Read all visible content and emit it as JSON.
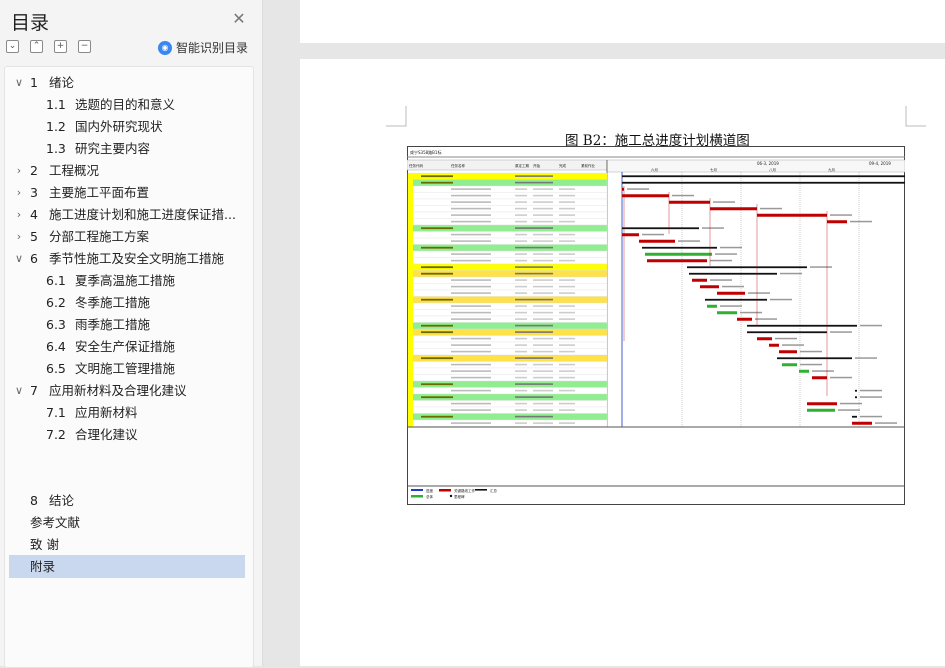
{
  "sidebar": {
    "title": "目录",
    "close_icon": "close-icon",
    "tools": [
      "collapse-all-icon",
      "expand-all-icon",
      "add-heading-icon",
      "remove-heading-icon"
    ],
    "smart_label": "智能识别目录",
    "items": [
      {
        "num": "1",
        "label": "绪论",
        "level": 1,
        "chevron": "down"
      },
      {
        "num": "1.1",
        "label": "选题的目的和意义",
        "level": 2
      },
      {
        "num": "1.2",
        "label": "国内外研究现状",
        "level": 2
      },
      {
        "num": "1.3",
        "label": "研究主要内容",
        "level": 2
      },
      {
        "num": "2",
        "label": "工程概况",
        "level": 1,
        "chevron": "right"
      },
      {
        "num": "3",
        "label": "主要施工平面布置",
        "level": 1,
        "chevron": "right"
      },
      {
        "num": "4",
        "label": "施工进度计划和施工进度保证措...",
        "level": 1,
        "chevron": "right"
      },
      {
        "num": "5",
        "label": "分部工程施工方案",
        "level": 1,
        "chevron": "right"
      },
      {
        "num": "6",
        "label": "季节性施工及安全文明施工措施",
        "level": 1,
        "chevron": "down"
      },
      {
        "num": "6.1",
        "label": "夏季高温施工措施",
        "level": 2
      },
      {
        "num": "6.2",
        "label": "冬季施工措施",
        "level": 2
      },
      {
        "num": "6.3",
        "label": "雨季施工措施",
        "level": 2
      },
      {
        "num": "6.4",
        "label": "安全生产保证措施",
        "level": 2
      },
      {
        "num": "6.5",
        "label": "文明施工管理措施",
        "level": 2
      },
      {
        "num": "7",
        "label": "应用新材料及合理化建议",
        "level": 1,
        "chevron": "down"
      },
      {
        "num": "7.1",
        "label": "应用新材料",
        "level": 2
      },
      {
        "num": "7.2",
        "label": "合理化建议",
        "level": 2
      }
    ],
    "tail_items": [
      {
        "num": "8",
        "label": "结论"
      },
      {
        "num": "",
        "label": "参考文献"
      },
      {
        "num": "",
        "label": "致 谢"
      },
      {
        "num": "",
        "label": "附录",
        "selected": true
      }
    ],
    "colors": {
      "selected_bg": "#c9d7ef",
      "smart_icon": "#3b86f0"
    }
  },
  "document": {
    "figure_title": "图 B2：施工总进度计划横道图",
    "gantt": {
      "header_left": [
        "任务代码",
        "任务名称",
        "原定工期",
        "开始",
        "完成",
        "紧前作业"
      ],
      "timeline_labels": [
        "06-3, 2019",
        "09-4, 2019"
      ],
      "month_labels": [
        "六月",
        "七月",
        "八月",
        "九月"
      ],
      "project_name": "咸宁S358路B1标",
      "legend_items": [
        "进度",
        "关键路线工作",
        "汇总",
        "总体",
        "里程碑"
      ],
      "colors": {
        "critical": "#c00000",
        "normal": "#30b030",
        "summary_row": "#ffff00",
        "group_row": "#90ee90",
        "progress": "#1e3cc8"
      }
    }
  }
}
